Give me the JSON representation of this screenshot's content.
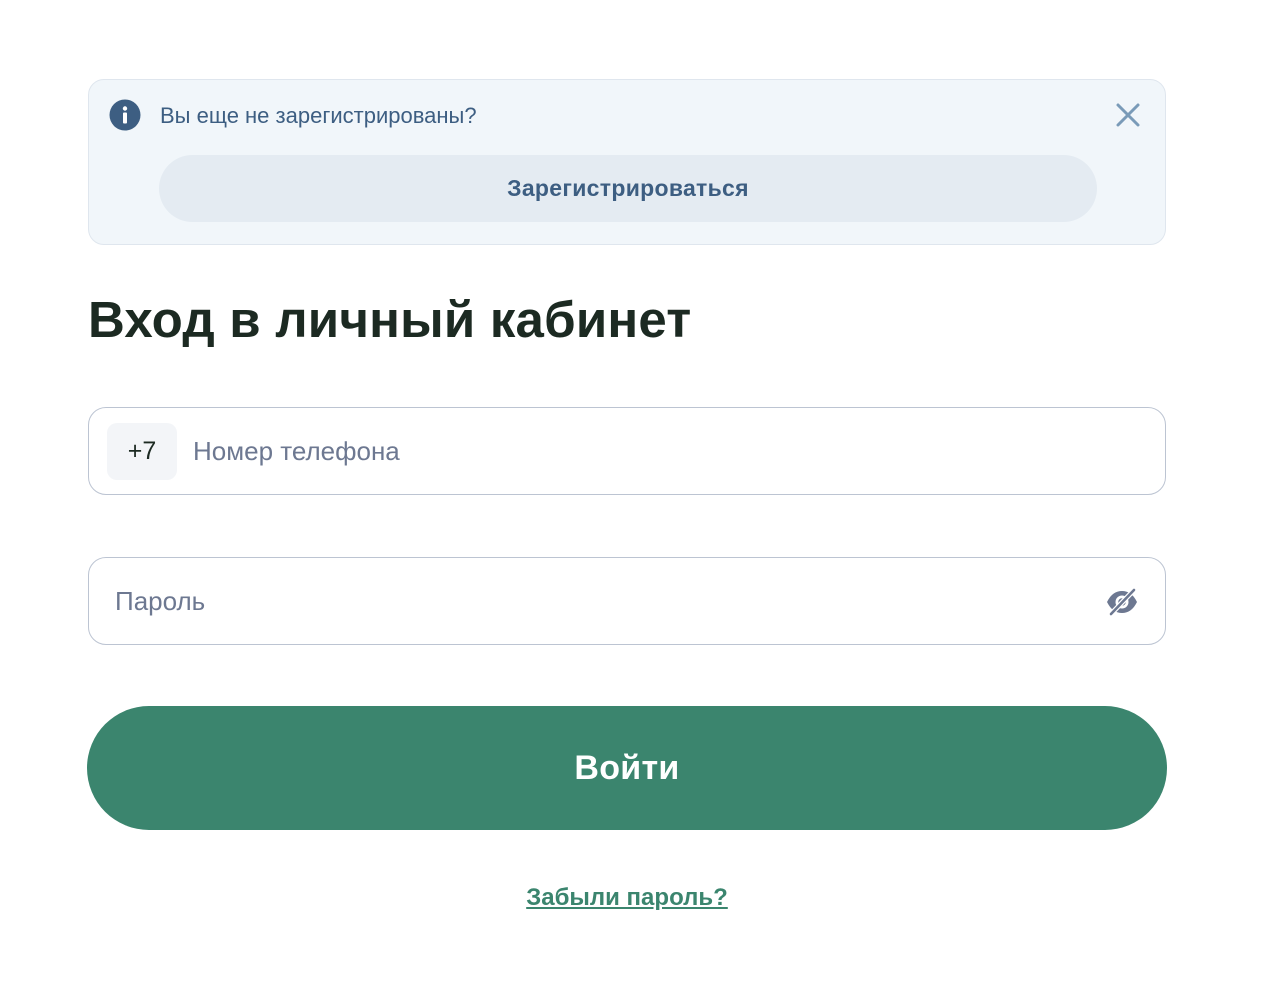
{
  "notice": {
    "text": "Вы еще не зарегистрированы?",
    "register_label": "Зарегистрироваться"
  },
  "title": "Вход в личный кабинет",
  "phone": {
    "prefix": "+7",
    "placeholder": "Номер телефона",
    "value": ""
  },
  "password": {
    "placeholder": "Пароль",
    "value": ""
  },
  "login_label": "Войти",
  "forgot_label": "Забыли пароль?",
  "colors": {
    "accent": "#3b856e",
    "notice_bg": "#f1f6fa",
    "notice_text": "#3d5e82",
    "title": "#1c2a22",
    "placeholder": "#6d7891"
  },
  "icons": {
    "info": "info-icon",
    "close": "close-icon",
    "password_toggle": "eye-off-icon"
  }
}
